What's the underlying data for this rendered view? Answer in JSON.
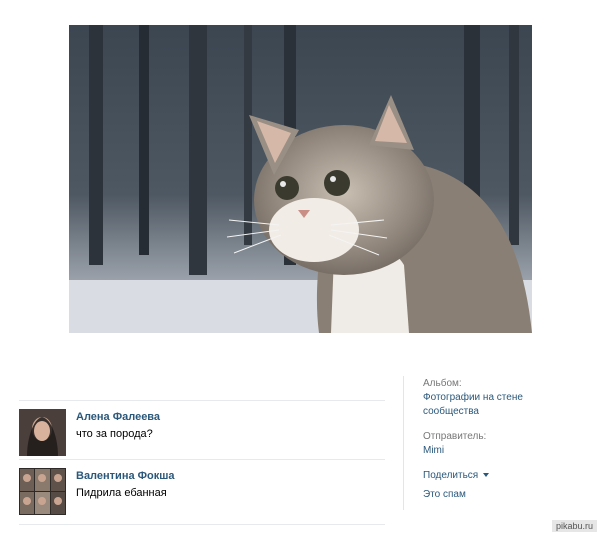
{
  "comments": [
    {
      "author": "Алена Фалеева",
      "text": "что за порода?"
    },
    {
      "author": "Валентина Фокша",
      "text": "Пидрила ебанная"
    }
  ],
  "sidebar": {
    "album_label": "Альбом:",
    "album_value": "Фотографии на стене сообщества",
    "sender_label": "Отправитель:",
    "sender_value": "Mimi",
    "share_label": "Поделиться",
    "spam_label": "Это спам"
  },
  "watermark": "pikabu.ru",
  "photo": {
    "icon": "cat-photo"
  },
  "colors": {
    "link": "#2b587a",
    "label": "#777777"
  }
}
